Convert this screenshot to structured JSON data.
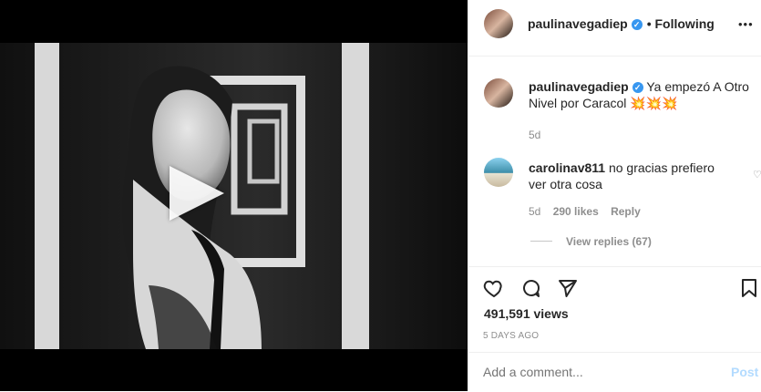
{
  "post": {
    "username": "paulinavegadiep",
    "follow_status": "• Following",
    "more_menu": "•••",
    "caption": "Ya empezó A Otro Nivel por Caracol",
    "caption_emojis": "💥💥💥",
    "caption_time": "5d",
    "views": "491,591 views",
    "date": "5 DAYS AGO"
  },
  "comment": {
    "username": "carolinav811",
    "text_line1": "no gracias prefiero",
    "text_line2": "ver otra cosa",
    "time": "5d",
    "likes": "290 likes",
    "reply": "Reply",
    "view_replies": "View replies (67)"
  },
  "add_comment": {
    "placeholder": "Add a comment...",
    "post_button": "Post"
  },
  "colors": {
    "blue": "#3897f0",
    "link_blue": "#b3dbff",
    "border": "#efefef"
  }
}
